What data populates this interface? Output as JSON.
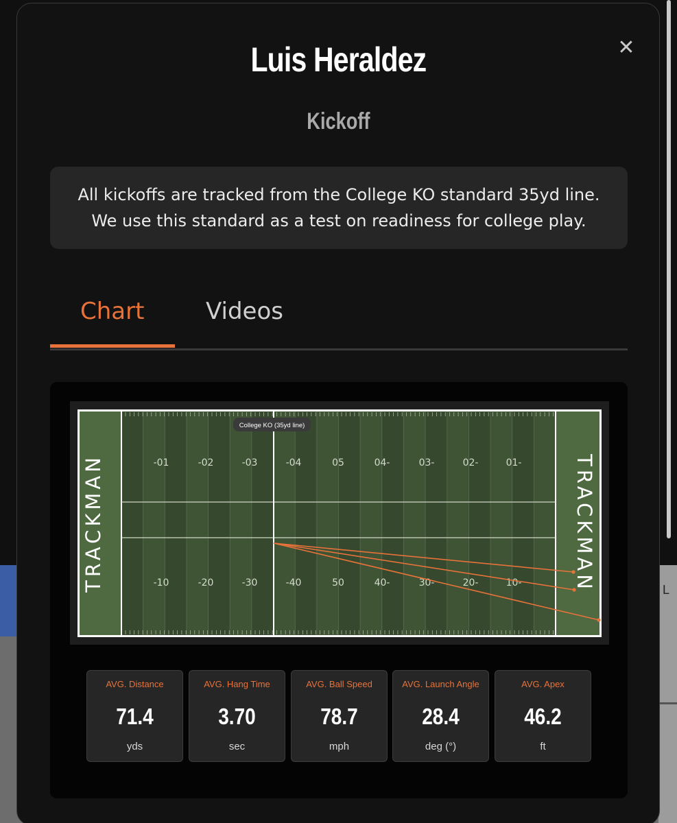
{
  "modal": {
    "title": "Luis Heraldez",
    "subtitle": "Kickoff",
    "close_icon": "close-icon",
    "notice_line1": "All kickoffs are tracked from the College KO standard 35yd line.",
    "notice_line2": "We use this standard as a test on readiness for college play."
  },
  "tabs": [
    {
      "label": "Chart",
      "active": true
    },
    {
      "label": "Videos",
      "active": false
    }
  ],
  "field": {
    "brand_left": "TRACKMAN",
    "brand_right": "TRACKMAN",
    "ko_marker_label": "College KO (35yd line)",
    "top_numbers": [
      "-01",
      "-02",
      "-03",
      "-04",
      "05",
      "04-",
      "03-",
      "02-",
      "01-"
    ],
    "bottom_numbers": [
      "-10",
      "-20",
      "-30",
      "-40",
      "50",
      "40-",
      "30-",
      "20-",
      "10-"
    ],
    "kick_count": 3
  },
  "stats": [
    {
      "label": "AVG. Distance",
      "value": "71.4",
      "unit": "yds"
    },
    {
      "label": "AVG. Hang Time",
      "value": "3.70",
      "unit": "sec"
    },
    {
      "label": "AVG. Ball Speed",
      "value": "78.7",
      "unit": "mph"
    },
    {
      "label": "AVG. Launch Angle",
      "value": "28.4",
      "unit": "deg (°)"
    },
    {
      "label": "AVG. Apex",
      "value": "46.2",
      "unit": "ft"
    }
  ],
  "colors": {
    "accent": "#e8733a",
    "field_dark": "#36482d",
    "field_light": "#3f5335",
    "endzone": "#4f6a41"
  },
  "background": {
    "edge_letter": "L"
  }
}
